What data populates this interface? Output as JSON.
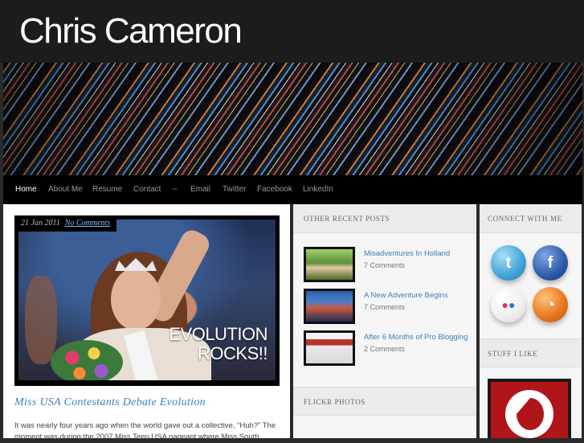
{
  "site": {
    "title": "Chris Cameron"
  },
  "nav": {
    "items": [
      {
        "label": "Home",
        "active": true
      },
      {
        "label": "About Me"
      },
      {
        "label": "Resume"
      },
      {
        "label": "Contact"
      },
      {
        "label": "--"
      },
      {
        "label": "Email"
      },
      {
        "label": "Twitter"
      },
      {
        "label": "Facebook"
      },
      {
        "label": "LinkedIn"
      }
    ]
  },
  "post": {
    "date": "21 Jan 2011",
    "comments_link": "No Comments",
    "image_text_line1": "EVOLUTION",
    "image_text_line2": "ROCKS!!",
    "title": "Miss USA Contestants Debate Evolution",
    "excerpt": "It was nearly four years ago when the world gave out a collective, “Huh?” The moment was during the 2007 Miss Teen USA pageant where Miss South"
  },
  "recent_posts": {
    "heading": "OTHER RECENT POSTS",
    "items": [
      {
        "title": "Misadventures In Holland",
        "comments": "7 Comments"
      },
      {
        "title": "A New Adventure Begins",
        "comments": "7 Comments"
      },
      {
        "title": "After 6 Months of Pro Blogging",
        "comments": "2 Comments"
      }
    ]
  },
  "flickr": {
    "heading": "FLICKR PHOTOS"
  },
  "connect": {
    "heading": "CONNECT WITH ME",
    "icons": [
      {
        "name": "twitter-icon",
        "glyph": "t",
        "color": "#3fa3d8"
      },
      {
        "name": "facebook-icon",
        "glyph": "f",
        "color": "#2d5aa8"
      },
      {
        "name": "flickr-icon",
        "glyph": "●●",
        "color": "#eeeeee"
      },
      {
        "name": "rss-icon",
        "glyph": "◔",
        "color": "#e8741f"
      }
    ]
  },
  "stuff": {
    "heading": "STUFF I LIKE"
  }
}
